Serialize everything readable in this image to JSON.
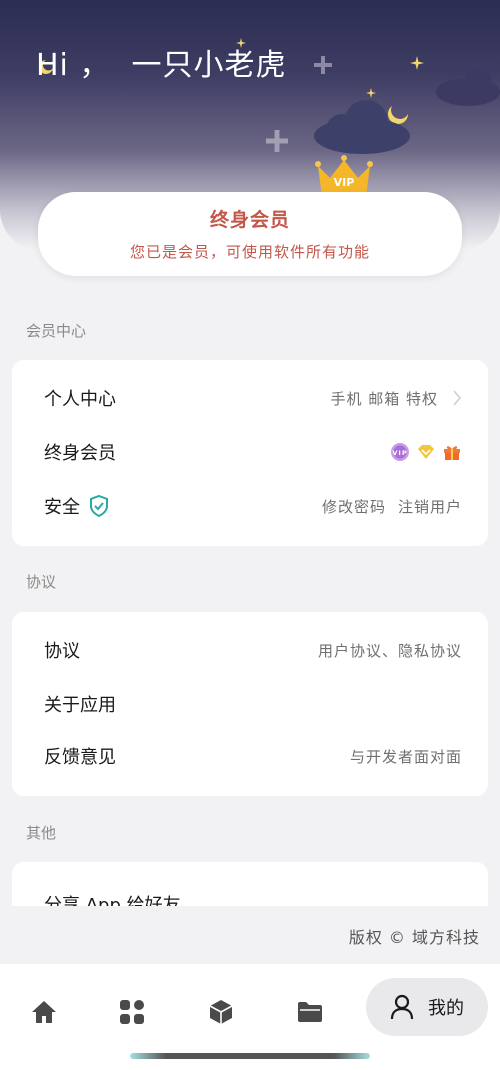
{
  "header": {
    "greeting": "Hi ，  一只小老虎"
  },
  "member_card": {
    "title": "终身会员",
    "subtitle": "您已是会员，可使用软件所有功能"
  },
  "sections": {
    "member_center": {
      "label": "会员中心",
      "rows": {
        "personal": {
          "label": "个人中心",
          "right": "手机 邮箱 特权"
        },
        "lifetime": {
          "label": "终身会员"
        },
        "security": {
          "label": "安全",
          "right_a": "修改密码",
          "right_b": "注销用户"
        }
      }
    },
    "agreement": {
      "label": "协议",
      "rows": {
        "agreement": {
          "label": "协议",
          "right": "用户协议、隐私协议"
        },
        "about": {
          "label": "关于应用"
        },
        "feedback": {
          "label": "反馈意见",
          "right": "与开发者面对面"
        }
      }
    },
    "other": {
      "label": "其他",
      "rows": {
        "share": {
          "label": "分享 App 给好友"
        }
      }
    }
  },
  "copyright": "版权 © 域方科技",
  "bottom_nav": {
    "items": [
      {
        "icon": "home-icon"
      },
      {
        "icon": "apps-grid-icon"
      },
      {
        "icon": "cube-icon"
      },
      {
        "icon": "folder-icon"
      }
    ],
    "active": {
      "icon": "person-icon",
      "label": "我的"
    }
  },
  "colors": {
    "accent_red": "#c2574a",
    "shield_teal": "#2aa9a0",
    "background": "#f2f2f4",
    "header_top": "#2c2d52"
  }
}
